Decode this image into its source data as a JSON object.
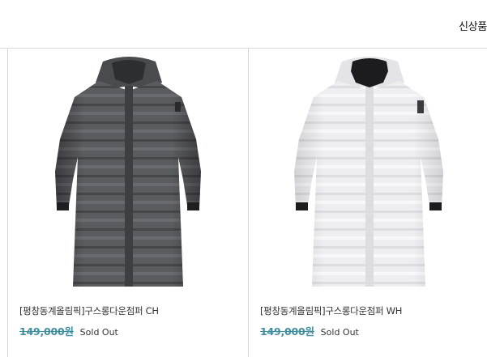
{
  "header": {
    "new_items_label": "신상품"
  },
  "products": [
    {
      "name": "[평창동계올림픽]구스롱다운점퍼 CH",
      "price": "149,000원",
      "status": "Sold Out",
      "color": "#5a5a5c"
    },
    {
      "name": "[평창동계올림픽]구스롱다운점퍼 WH",
      "price": "149,000원",
      "status": "Sold Out",
      "color": "#f1f1f3"
    }
  ]
}
